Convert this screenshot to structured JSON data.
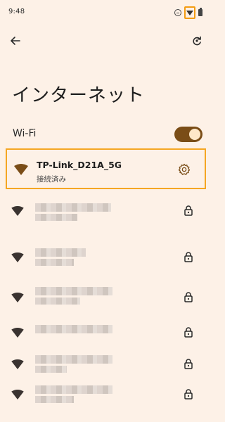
{
  "status_bar": {
    "time": "9:48",
    "icons": [
      "do-not-disturb-icon",
      "wifi-icon",
      "battery-icon"
    ]
  },
  "toolbar": {
    "back_icon": "arrow-left-icon",
    "refresh_icon": "refresh-icon"
  },
  "title": "インターネット",
  "wifi": {
    "label": "Wi-Fi",
    "enabled": true
  },
  "connected_network": {
    "name": "TP-Link_D21A_5G",
    "status": "接続済み",
    "settings_icon": "gear-icon"
  },
  "networks": [
    {
      "name": "",
      "locked": true
    },
    {
      "name": "",
      "locked": true
    },
    {
      "name": "",
      "locked": true
    },
    {
      "name": "",
      "locked": true
    },
    {
      "name": "",
      "locked": true
    },
    {
      "name": "",
      "locked": true
    }
  ],
  "colors": {
    "background": "#fdf1e7",
    "accent": "#7a4d17",
    "highlight_border": "#f5a623",
    "wifi_icon": "#7a4d17",
    "network_icon": "#3a3330"
  }
}
